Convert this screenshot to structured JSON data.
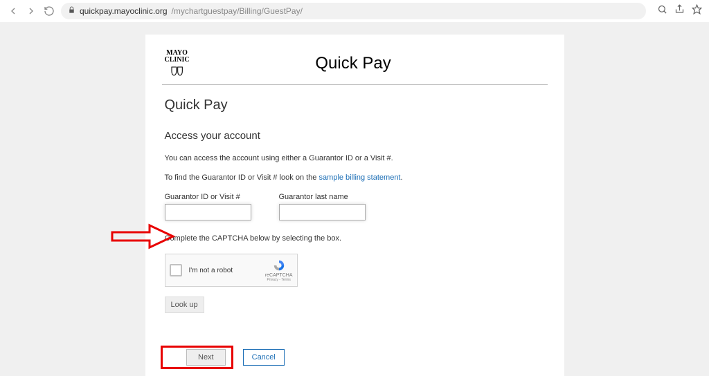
{
  "browser": {
    "url_host": "quickpay.mayoclinic.org",
    "url_path": "/mychartguestpay/Billing/GuestPay/"
  },
  "header": {
    "logo_line1": "MAYO",
    "logo_line2": "CLINIC",
    "title": "Quick Pay"
  },
  "page": {
    "heading": "Quick Pay",
    "subheading": "Access your account",
    "intro_text": "You can access the account using either a Guarantor ID or a Visit #.",
    "find_text_prefix": "To find the Guarantor ID or Visit # look on the ",
    "find_link": "sample billing statement",
    "find_text_suffix": ".",
    "field1_label": "Guarantor ID or Visit #",
    "field2_label": "Guarantor last name",
    "captcha_instruction": "Complete the CAPTCHA below by selecting the box.",
    "captcha_text": "I'm not a robot",
    "captcha_brand": "reCAPTCHA",
    "captcha_legal": "Privacy - Terms",
    "lookup_label": "Look up",
    "next_label": "Next",
    "cancel_label": "Cancel"
  }
}
